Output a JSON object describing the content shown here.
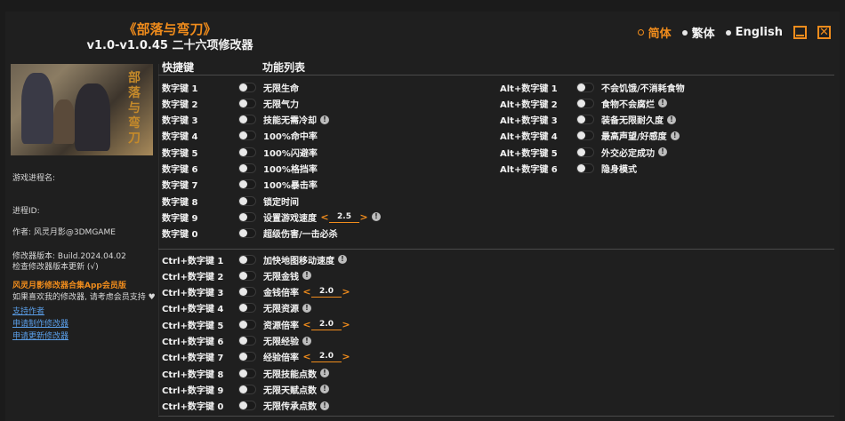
{
  "header": {
    "game_title": "《部落与弯刀》",
    "version": "v1.0-v1.0.45 二十六项修改器",
    "languages": [
      {
        "label": "简体",
        "active": true
      },
      {
        "label": "繁体",
        "active": false
      },
      {
        "label": "English",
        "active": false
      }
    ]
  },
  "sidebar": {
    "cover_logo": "部落与弯刀",
    "process_name_label": "游戏进程名:",
    "process_id_label": "进程ID:",
    "author": "作者: 风灵月影@3DMGAME",
    "trainer_version": "修改器版本: Build.2024.04.02",
    "check_update": "检查修改器版本更新 (√)",
    "app_member": "风灵月影修改器合集App会员版",
    "support_text": "如果喜欢我的修改器, 请考虑会员支持 ♥",
    "links": [
      "支持作者",
      "申请制作修改器",
      "申请更新修改器"
    ]
  },
  "columns": {
    "hotkey_header": "快捷键",
    "function_header": "功能列表"
  },
  "group1": [
    {
      "key": "数字键 1",
      "label": "无限生命"
    },
    {
      "key": "数字键 2",
      "label": "无限气力"
    },
    {
      "key": "数字键 3",
      "label": "技能无需冷却",
      "warn": true
    },
    {
      "key": "数字键 4",
      "label": "100%命中率"
    },
    {
      "key": "数字键 5",
      "label": "100%闪避率"
    },
    {
      "key": "数字键 6",
      "label": "100%格挡率"
    },
    {
      "key": "数字键 7",
      "label": "100%暴击率"
    },
    {
      "key": "数字键 8",
      "label": "锁定时间"
    },
    {
      "key": "数字键 9",
      "label": "设置游戏速度",
      "value": "2.5",
      "warn": true
    },
    {
      "key": "数字键 0",
      "label": "超级伤害/一击必杀"
    }
  ],
  "group2": [
    {
      "key": "Ctrl+数字键 1",
      "label": "加快地图移动速度",
      "warn": true
    },
    {
      "key": "Ctrl+数字键 2",
      "label": "无限金钱",
      "warn": true
    },
    {
      "key": "Ctrl+数字键 3",
      "label": "金钱倍率",
      "value": "2.0"
    },
    {
      "key": "Ctrl+数字键 4",
      "label": "无限资源",
      "warn": true
    },
    {
      "key": "Ctrl+数字键 5",
      "label": "资源倍率",
      "value": "2.0"
    },
    {
      "key": "Ctrl+数字键 6",
      "label": "无限经验",
      "warn": true
    },
    {
      "key": "Ctrl+数字键 7",
      "label": "经验倍率",
      "value": "2.0"
    },
    {
      "key": "Ctrl+数字键 8",
      "label": "无限技能点数",
      "warn": true
    },
    {
      "key": "Ctrl+数字键 9",
      "label": "无限天赋点数",
      "warn": true
    },
    {
      "key": "Ctrl+数字键 0",
      "label": "无限传承点数",
      "warn": true
    }
  ],
  "group3": [
    {
      "key": "Alt+数字键 1",
      "label": "不会饥饿/不消耗食物"
    },
    {
      "key": "Alt+数字键 2",
      "label": "食物不会腐烂",
      "warn": true
    },
    {
      "key": "Alt+数字键 3",
      "label": "装备无限耐久度",
      "warn": true
    },
    {
      "key": "Alt+数字键 4",
      "label": "最高声望/好感度",
      "warn": true
    },
    {
      "key": "Alt+数字键 5",
      "label": "外交必定成功",
      "warn": true
    },
    {
      "key": "Alt+数字键 6",
      "label": "隐身模式"
    }
  ],
  "colors": {
    "accent": "#f08c1c",
    "background": "#1f1f1f",
    "link": "#5a9ee8"
  }
}
